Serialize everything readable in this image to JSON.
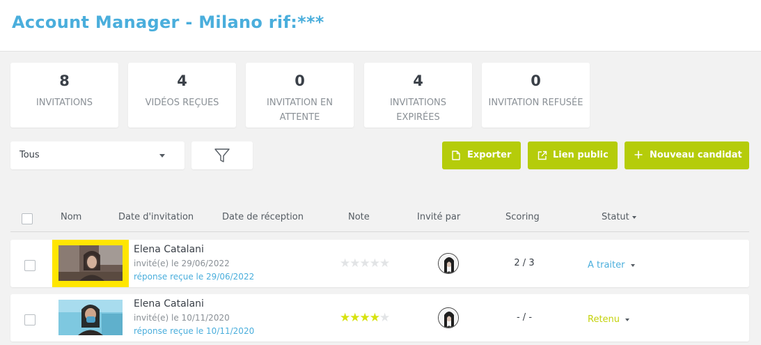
{
  "header": {
    "title": "Account Manager - Milano rif:***"
  },
  "stats": [
    {
      "value": "8",
      "label": "INVITATIONS"
    },
    {
      "value": "4",
      "label": "VIDÉOS REÇUES"
    },
    {
      "value": "0",
      "label": "INVITATION EN ATTENTE"
    },
    {
      "value": "4",
      "label": "INVITATIONS EXPIRÉES"
    },
    {
      "value": "0",
      "label": "INVITATION REFUSÉE"
    }
  ],
  "filter": {
    "selected": "Tous",
    "filter_icon": "funnel-icon"
  },
  "actions": {
    "export_label": "Exporter",
    "public_link_label": "Lien public",
    "new_candidate_label": "Nouveau candidat"
  },
  "table": {
    "columns": {
      "name": "Nom",
      "invite_date": "Date d'invitation",
      "receive_date": "Date de réception",
      "note": "Note",
      "invited_by": "Invité par",
      "scoring": "Scoring",
      "status": "Statut"
    },
    "rows": [
      {
        "name": "Elena Catalani",
        "invited": "invité(e) le 29/06/2022",
        "reply": "réponse reçue le 29/06/2022",
        "rating": 0,
        "scoring": "2 / 3",
        "status": "A traiter",
        "status_color": "#4aaedc"
      },
      {
        "name": "Elena Catalani",
        "invited": "invité(e) le 10/11/2020",
        "reply": "réponse reçue le 10/11/2020",
        "rating": 4,
        "scoring": "- / -",
        "status": "Retenu",
        "status_color": "#c4d20c"
      }
    ]
  },
  "colors": {
    "accent_blue": "#4aaedc",
    "button_green": "#b5cc0a",
    "highlight_yellow": "#ffe600"
  }
}
